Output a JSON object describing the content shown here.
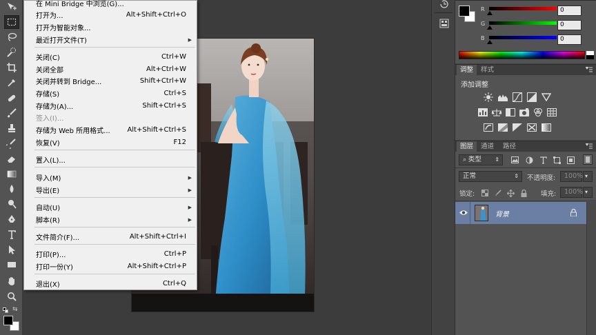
{
  "file_menu": {
    "items": [
      {
        "label": "在 Mini Bridge 中浏览(G)...",
        "shortcut": ""
      },
      {
        "label": "打开为...",
        "shortcut": "Alt+Shift+Ctrl+O"
      },
      {
        "label": "打开为智能对象...",
        "shortcut": ""
      },
      {
        "label": "最近打开文件(T)",
        "shortcut": ""
      },
      {
        "label": "关闭(C)",
        "shortcut": "Ctrl+W"
      },
      {
        "label": "关闭全部",
        "shortcut": "Alt+Ctrl+W"
      },
      {
        "label": "关闭并转到 Bridge...",
        "shortcut": "Shift+Ctrl+W"
      },
      {
        "label": "存储(S)",
        "shortcut": "Ctrl+S"
      },
      {
        "label": "存储为(A)...",
        "shortcut": "Shift+Ctrl+S"
      },
      {
        "label": "签入(I)...",
        "shortcut": ""
      },
      {
        "label": "存储为 Web 所用格式...",
        "shortcut": "Alt+Shift+Ctrl+S"
      },
      {
        "label": "恢复(V)",
        "shortcut": "F12"
      },
      {
        "label": "置入(L)...",
        "shortcut": ""
      },
      {
        "label": "导入(M)",
        "shortcut": ""
      },
      {
        "label": "导出(E)",
        "shortcut": ""
      },
      {
        "label": "自动(U)",
        "shortcut": ""
      },
      {
        "label": "脚本(R)",
        "shortcut": ""
      },
      {
        "label": "文件简介(F)...",
        "shortcut": "Alt+Shift+Ctrl+I"
      },
      {
        "label": "打印(P)...",
        "shortcut": "Ctrl+P"
      },
      {
        "label": "打印一份(Y)",
        "shortcut": "Alt+Shift+Ctrl+P"
      },
      {
        "label": "退出(X)",
        "shortcut": "Ctrl+Q"
      }
    ]
  },
  "color_panel": {
    "r_label": "R",
    "g_label": "G",
    "b_label": "B",
    "r_value": "0",
    "g_value": "0",
    "b_value": "0",
    "foreground_color": "#000000",
    "background_color": "#ffffff"
  },
  "adjustments_panel": {
    "tab_adjust": "调整",
    "tab_styles": "样式",
    "heading": "添加调整"
  },
  "layers_panel": {
    "tab_layers": "图层",
    "tab_channels": "通道",
    "tab_paths": "路径",
    "filter_kind": "类型",
    "blend_mode": "正常",
    "opacity_label": "不透明度:",
    "opacity_value": "100%",
    "lock_label": "锁定:",
    "fill_label": "填充:",
    "fill_value": "100%",
    "layer_name": "背景"
  },
  "colors": {
    "accent_selected_layer": "#6a7fa3",
    "menu_bg": "#f0f0f0",
    "panel_bg": "#535353"
  }
}
